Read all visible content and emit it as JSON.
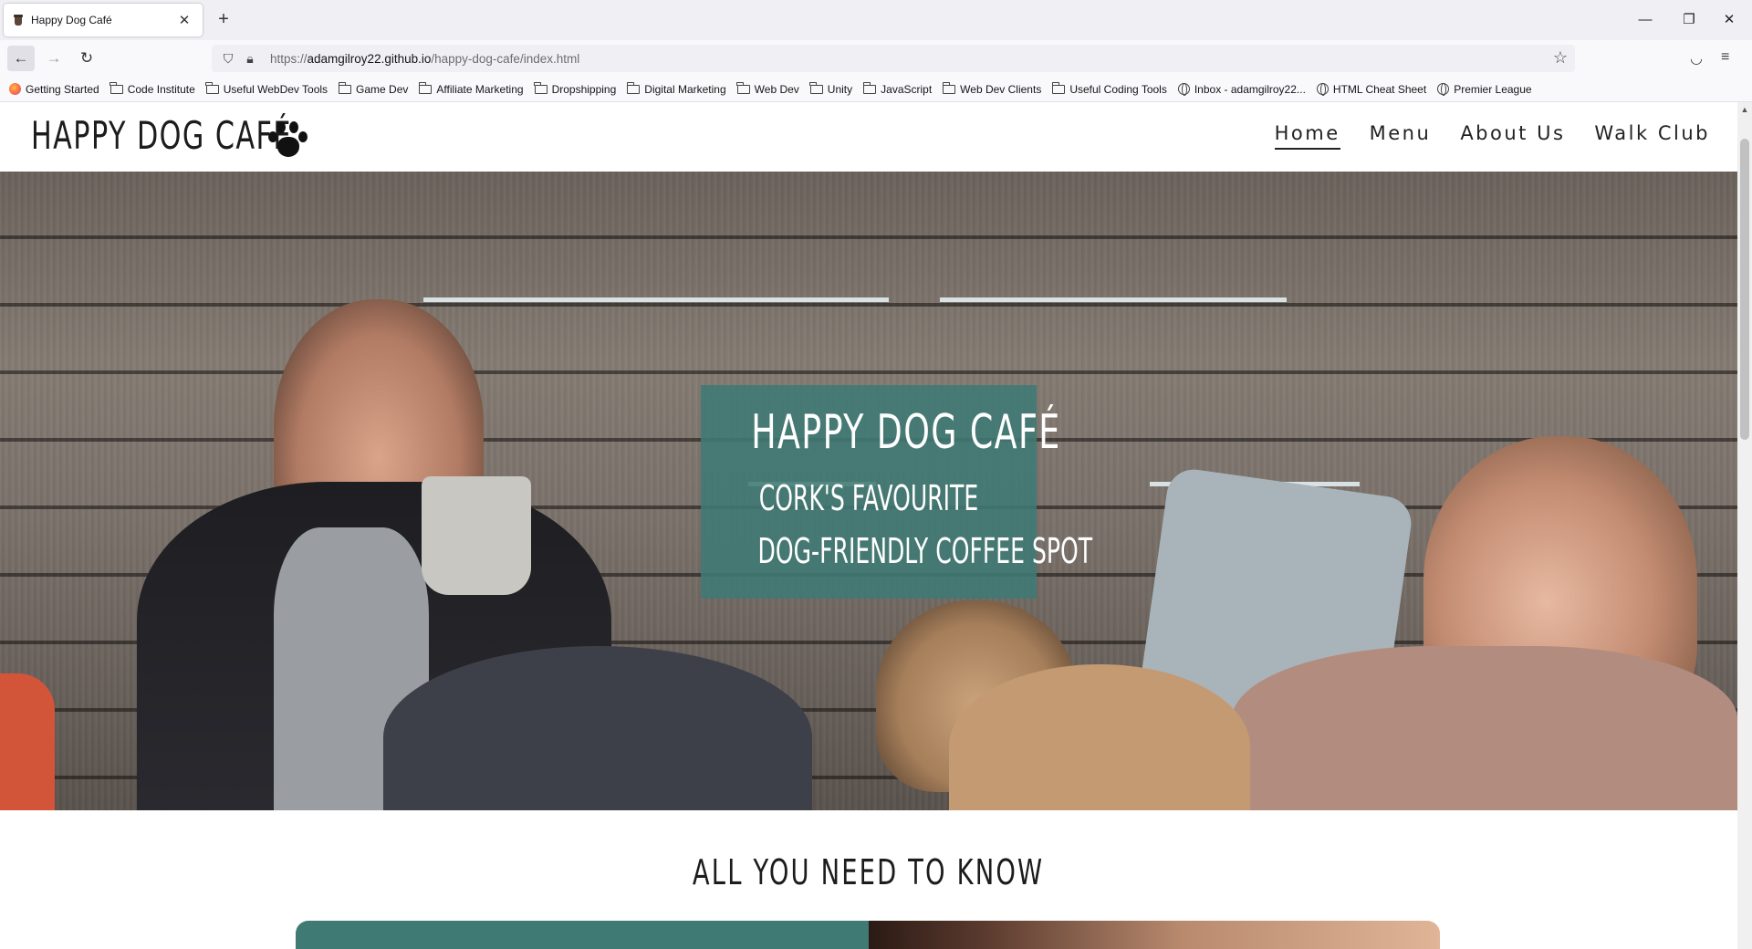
{
  "browser": {
    "tab_title": "Happy Dog Café",
    "tab_close": "✕",
    "new_tab": "+",
    "url_protocol": "https://",
    "url_host": "adamgilroy22.github.io",
    "url_path": "/happy-dog-cafe/index.html",
    "window_controls": {
      "minimize": "—",
      "maximize": "❐",
      "close": "✕"
    },
    "bookmarks": [
      {
        "label": "Getting Started",
        "icon": "firefox-icon"
      },
      {
        "label": "Code Institute",
        "icon": "folder-icon"
      },
      {
        "label": "Useful WebDev Tools",
        "icon": "folder-icon"
      },
      {
        "label": "Game Dev",
        "icon": "folder-icon"
      },
      {
        "label": "Affiliate Marketing",
        "icon": "folder-icon"
      },
      {
        "label": "Dropshipping",
        "icon": "folder-icon"
      },
      {
        "label": "Digital Marketing",
        "icon": "folder-icon"
      },
      {
        "label": "Web Dev",
        "icon": "folder-icon"
      },
      {
        "label": "Unity",
        "icon": "folder-icon"
      },
      {
        "label": "JavaScript",
        "icon": "folder-icon"
      },
      {
        "label": "Web Dev Clients",
        "icon": "folder-icon"
      },
      {
        "label": "Useful Coding Tools",
        "icon": "folder-icon"
      },
      {
        "label": "Inbox - adamgilroy22...",
        "icon": "globe-icon"
      },
      {
        "label": "HTML Cheat Sheet",
        "icon": "globe-icon"
      },
      {
        "label": "Premier League",
        "icon": "globe-icon"
      }
    ]
  },
  "site": {
    "logo": "HAPPY DOG CAFÉ",
    "nav": [
      {
        "label": "Home",
        "active": true
      },
      {
        "label": "Menu",
        "active": false
      },
      {
        "label": "About Us",
        "active": false
      },
      {
        "label": "Walk Club",
        "active": false
      }
    ],
    "hero": {
      "title": "HAPPY DOG CAFÉ",
      "subtitle_line1": "CORK'S FAVOURITE",
      "subtitle_line2": "DOG-FRIENDLY COFFEE SPOT"
    },
    "section_title": "ALL YOU NEED TO KNOW"
  },
  "colors": {
    "accent_teal": "#3f7a74",
    "text_dark": "#1c1c1c"
  }
}
